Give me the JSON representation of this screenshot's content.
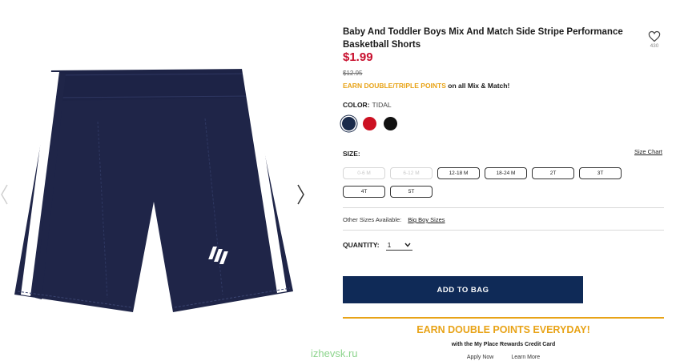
{
  "product": {
    "title": "Baby And Toddler Boys Mix And Match Side Stripe Performance Basketball Shorts",
    "price": "$1.99",
    "old_price": "$12.95",
    "favorites_count": "430",
    "image_icon": "product-shorts-image"
  },
  "promo_points": {
    "highlight": "EARN DOUBLE/TRIPLE POINTS",
    "rest": " on all Mix & Match!",
    "highlight_color": "#e8a317"
  },
  "color": {
    "label": "COLOR:",
    "selected": "TIDAL",
    "swatches": [
      {
        "name": "tidal",
        "hex": "#1a2a4a",
        "selected": true
      },
      {
        "name": "red",
        "hex": "#cc1122",
        "selected": false
      },
      {
        "name": "black",
        "hex": "#111111",
        "selected": false
      }
    ]
  },
  "size": {
    "label": "SIZE:",
    "chart_link": "Size Chart",
    "options": [
      {
        "label": "0-6 M",
        "available": false
      },
      {
        "label": "6-12 M",
        "available": false
      },
      {
        "label": "12-18 M",
        "available": true
      },
      {
        "label": "18-24 M",
        "available": true
      },
      {
        "label": "2T",
        "available": true
      },
      {
        "label": "3T",
        "available": true
      },
      {
        "label": "4T",
        "available": true
      },
      {
        "label": "5T",
        "available": true
      }
    ]
  },
  "other_sizes": {
    "label": "Other Sizes Available:",
    "link": "Big Boy Sizes"
  },
  "quantity": {
    "label": "QUANTITY:",
    "value": "1"
  },
  "add_to_bag": "ADD TO BAG",
  "rewards": {
    "title": "EARN DOUBLE POINTS EVERYDAY!",
    "subtitle": "with the My Place Rewards Credit Card",
    "apply": "Apply Now",
    "learn": "Learn More"
  },
  "watermark": "izhevsk.ru",
  "colors": {
    "brand_navy": "#0f2a57",
    "price_red": "#c8102e",
    "accent_gold": "#e8a317"
  }
}
